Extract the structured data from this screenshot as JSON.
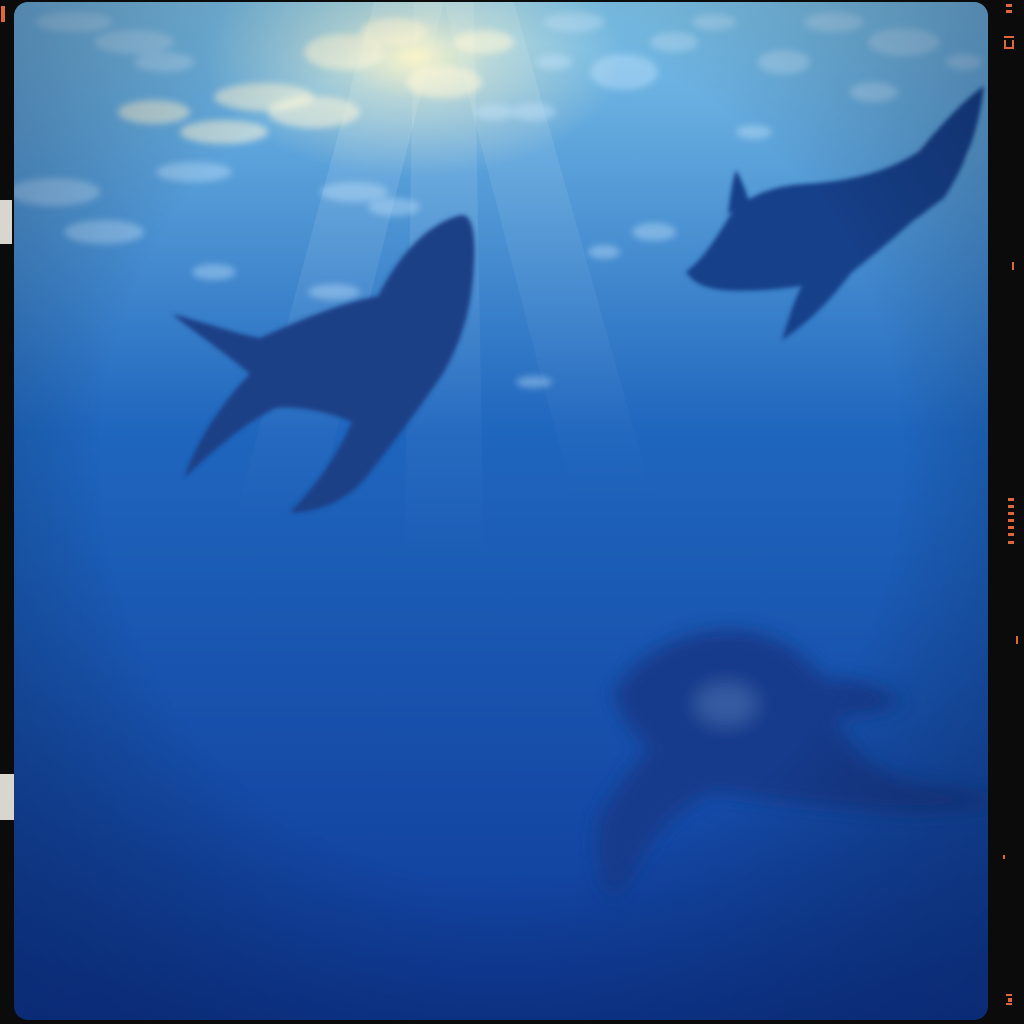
{
  "palette": {
    "film_border": "#0c0b0b",
    "water_surface": "#7ec4ea",
    "water_mid": "#1f66be",
    "water_deep": "#0f3a99",
    "sunlight": "#fff6c8",
    "dolphin_near": "#1b3f86",
    "dolphin_far": "#193f8a",
    "dolphin_blur": "#173b8c",
    "rebate_marking": "#e0673a",
    "edge_notch": "#d9d6cf"
  },
  "scene": {
    "subjects": [
      {
        "name": "dolphin",
        "count": 3
      }
    ],
    "icons": [
      "dolphin-silhouette-icon",
      "sunlight-ray-icon",
      "film-frame-icon"
    ]
  }
}
